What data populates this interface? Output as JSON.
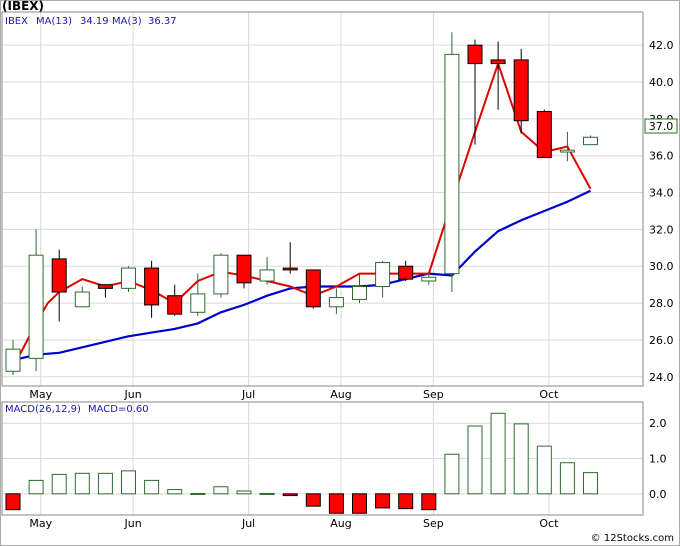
{
  "title": "(IBEX)",
  "credit": "© 12Stocks.com",
  "colors": {
    "up_candle": "#ffffff",
    "up_border": "#2e6b2e",
    "down_candle": "#ff0000",
    "down_border": "#000000",
    "ma13": "#0000cc",
    "ma3": "#e00000",
    "macd_pos": "#ffffff",
    "macd_neg": "#ff0000",
    "grid": "#d9d9d9",
    "legend_text": "#1a1aaa",
    "badge_border": "#1a7a1a"
  },
  "chart_data": [
    {
      "type": "candlestick",
      "ticker_label": "IBEX",
      "legend": [
        {
          "name": "MA(13)",
          "value": "34.19"
        },
        {
          "name": "MA(3)",
          "value": "36.37"
        }
      ],
      "last_price_label": "37.0",
      "ylim": [
        23.5,
        43.8
      ],
      "ytick_labels": [
        "24.0",
        "26.0",
        "28.0",
        "30.0",
        "32.0",
        "34.0",
        "36.0",
        "38.0",
        "40.0",
        "42.0"
      ],
      "xtick_labels": [
        "May",
        "Jun",
        "Jul",
        "Aug",
        "Sep",
        "Oct"
      ],
      "xtick_positions": [
        1.2,
        5.2,
        10.2,
        14.2,
        18.2,
        23.2
      ],
      "grid": true,
      "candles": [
        {
          "open": 24.3,
          "high": 26.0,
          "low": 24.1,
          "close": 25.5
        },
        {
          "open": 25.0,
          "high": 32.0,
          "low": 24.3,
          "close": 30.6
        },
        {
          "open": 30.4,
          "high": 30.9,
          "low": 27.0,
          "close": 28.6
        },
        {
          "open": 27.8,
          "high": 28.9,
          "low": 27.8,
          "close": 28.6
        },
        {
          "open": 29.0,
          "high": 29.0,
          "low": 28.3,
          "close": 28.8
        },
        {
          "open": 28.8,
          "high": 30.0,
          "low": 28.6,
          "close": 29.9
        },
        {
          "open": 29.9,
          "high": 30.3,
          "low": 27.2,
          "close": 27.9
        },
        {
          "open": 28.4,
          "high": 29.0,
          "low": 27.3,
          "close": 27.4
        },
        {
          "open": 27.5,
          "high": 29.6,
          "low": 27.3,
          "close": 28.5
        },
        {
          "open": 28.5,
          "high": 30.7,
          "low": 28.3,
          "close": 30.6
        },
        {
          "open": 30.6,
          "high": 30.6,
          "low": 28.8,
          "close": 29.1
        },
        {
          "open": 29.2,
          "high": 30.5,
          "low": 29.0,
          "close": 29.8
        },
        {
          "open": 29.9,
          "high": 31.3,
          "low": 29.6,
          "close": 29.8
        },
        {
          "open": 29.8,
          "high": 29.8,
          "low": 27.7,
          "close": 27.8
        },
        {
          "open": 27.8,
          "high": 28.8,
          "low": 27.4,
          "close": 28.3
        },
        {
          "open": 28.2,
          "high": 29.6,
          "low": 28.0,
          "close": 28.9
        },
        {
          "open": 28.9,
          "high": 30.3,
          "low": 28.3,
          "close": 30.2
        },
        {
          "open": 30.0,
          "high": 30.3,
          "low": 29.2,
          "close": 29.3
        },
        {
          "open": 29.2,
          "high": 29.6,
          "low": 29.0,
          "close": 29.4
        },
        {
          "open": 29.6,
          "high": 42.7,
          "low": 28.6,
          "close": 41.5
        },
        {
          "open": 42.0,
          "high": 42.3,
          "low": 36.6,
          "close": 41.0
        },
        {
          "open": 41.2,
          "high": 42.2,
          "low": 38.5,
          "close": 41.0
        },
        {
          "open": 41.2,
          "high": 41.8,
          "low": 37.2,
          "close": 37.9
        },
        {
          "open": 38.4,
          "high": 38.5,
          "low": 35.9,
          "close": 35.9
        },
        {
          "open": 36.2,
          "high": 37.3,
          "low": 35.7,
          "close": 36.3
        },
        {
          "open": 36.6,
          "high": 37.1,
          "low": 36.6,
          "close": 37.0
        }
      ],
      "ma13": [
        {
          "x": 0,
          "y": 24.5
        },
        {
          "x": 1,
          "y": 26.9
        },
        {
          "x": 1.5,
          "y": 28.0
        },
        {
          "x": 2,
          "y": 28.6
        },
        {
          "x": 3,
          "y": 29.3
        },
        {
          "x": 4,
          "y": 28.9
        },
        {
          "x": 5,
          "y": 29.2
        },
        {
          "x": 6,
          "y": 28.7
        },
        {
          "x": 7,
          "y": 28.0
        },
        {
          "x": 8,
          "y": 29.2
        },
        {
          "x": 9,
          "y": 29.7
        },
        {
          "x": 10,
          "y": 29.5
        },
        {
          "x": 11,
          "y": 29.2
        },
        {
          "x": 12,
          "y": 28.9
        },
        {
          "x": 13,
          "y": 28.4
        },
        {
          "x": 14,
          "y": 28.9
        },
        {
          "x": 15,
          "y": 29.6
        },
        {
          "x": 16,
          "y": 29.6
        },
        {
          "x": 17,
          "y": 29.6
        },
        {
          "x": 18,
          "y": 29.6
        },
        {
          "x": 19,
          "y": 33.5
        },
        {
          "x": 20,
          "y": 37.3
        },
        {
          "x": 21,
          "y": 41.0
        },
        {
          "x": 22,
          "y": 37.3
        },
        {
          "x": 23,
          "y": 36.2
        },
        {
          "x": 24,
          "y": 36.5
        },
        {
          "x": 25,
          "y": 34.2
        }
      ],
      "ma3": [
        {
          "x": 0,
          "y": 24.9
        },
        {
          "x": 1,
          "y": 25.2
        },
        {
          "x": 2,
          "y": 25.3
        },
        {
          "x": 3,
          "y": 25.6
        },
        {
          "x": 4,
          "y": 25.9
        },
        {
          "x": 5,
          "y": 26.2
        },
        {
          "x": 6,
          "y": 26.4
        },
        {
          "x": 7,
          "y": 26.6
        },
        {
          "x": 8,
          "y": 26.9
        },
        {
          "x": 9,
          "y": 27.5
        },
        {
          "x": 10,
          "y": 27.9
        },
        {
          "x": 11,
          "y": 28.4
        },
        {
          "x": 12,
          "y": 28.8
        },
        {
          "x": 13,
          "y": 28.9
        },
        {
          "x": 14,
          "y": 28.9
        },
        {
          "x": 15,
          "y": 28.9
        },
        {
          "x": 16,
          "y": 29.0
        },
        {
          "x": 17,
          "y": 29.3
        },
        {
          "x": 18,
          "y": 29.6
        },
        {
          "x": 19,
          "y": 29.5
        },
        {
          "x": 20,
          "y": 30.8
        },
        {
          "x": 21,
          "y": 31.9
        },
        {
          "x": 22,
          "y": 32.5
        },
        {
          "x": 23,
          "y": 33.0
        },
        {
          "x": 24,
          "y": 33.5
        },
        {
          "x": 25,
          "y": 34.1
        }
      ]
    },
    {
      "type": "bar",
      "label": "MACD(26,12,9)",
      "legend_value": "MACD=0.60",
      "ylim": [
        -0.6,
        2.6
      ],
      "ytick_labels": [
        "0.0",
        "1.0",
        "2.0"
      ],
      "values": [
        -0.45,
        0.38,
        0.55,
        0.58,
        0.58,
        0.65,
        0.38,
        0.12,
        0.01,
        0.2,
        0.08,
        0.01,
        -0.05,
        -0.35,
        -0.55,
        -0.55,
        -0.4,
        -0.42,
        -0.45,
        1.12,
        1.92,
        2.28,
        1.98,
        1.35,
        0.88,
        0.6
      ]
    }
  ]
}
